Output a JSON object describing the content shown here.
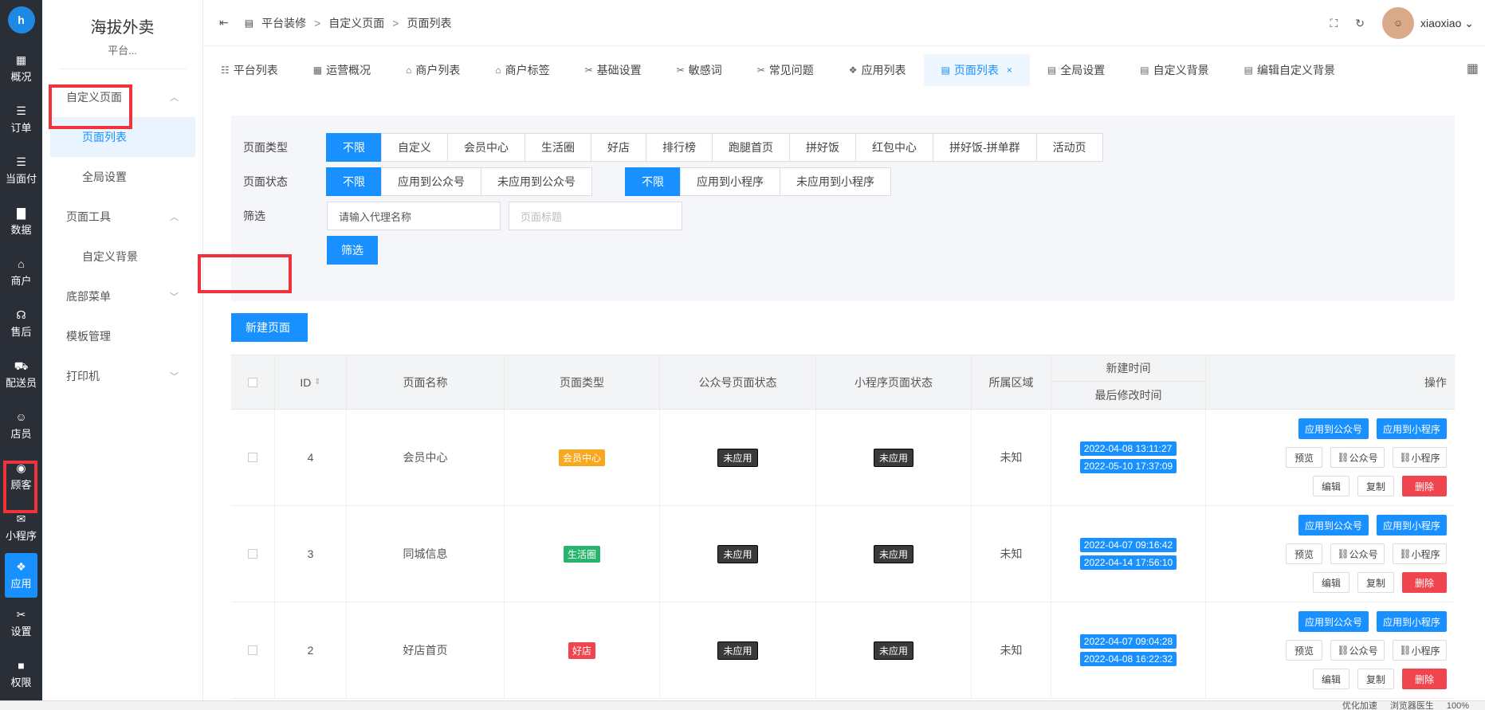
{
  "rail": {
    "items": [
      {
        "icon": "dashboard-icon",
        "glyph": "▦",
        "label": "概况"
      },
      {
        "icon": "list-icon",
        "glyph": "☰",
        "label": "订单"
      },
      {
        "icon": "list-icon",
        "glyph": "☰",
        "label": "当面付"
      },
      {
        "icon": "chart-icon",
        "glyph": "▇",
        "label": "数据"
      },
      {
        "icon": "store-icon",
        "glyph": "⌂",
        "label": "商户"
      },
      {
        "icon": "headset-icon",
        "glyph": "☊",
        "label": "售后"
      },
      {
        "icon": "truck-icon",
        "glyph": "⛟",
        "label": "配送员"
      },
      {
        "icon": "user-icon",
        "glyph": "☺",
        "label": "店员"
      },
      {
        "icon": "customer-icon",
        "glyph": "◉",
        "label": "顾客"
      },
      {
        "icon": "wechat-icon",
        "glyph": "✉",
        "label": "小程序"
      },
      {
        "icon": "apps-icon",
        "glyph": "❖",
        "label": "应用"
      },
      {
        "icon": "settings-icon",
        "glyph": "✂",
        "label": "设置"
      },
      {
        "icon": "lock-icon",
        "glyph": "■",
        "label": "权限"
      }
    ]
  },
  "sidebar": {
    "brand": "海拔外卖",
    "brand_sub": "平台...",
    "groups": [
      {
        "label": "自定义页面",
        "chev": "^"
      },
      {
        "label": "页面工具",
        "chev": "^"
      },
      {
        "label": "底部菜单",
        "chev": "v"
      },
      {
        "label": "模板管理",
        "chev": ""
      },
      {
        "label": "打印机",
        "chev": "v"
      }
    ],
    "subs": [
      "页面列表",
      "全局设置",
      "自定义背景"
    ]
  },
  "header": {
    "fold_icon": "⇤",
    "crumbs": [
      "平台装修",
      ">",
      "自定义页面",
      ">",
      "页面列表"
    ],
    "username": "xiaoxiao"
  },
  "tabs": [
    {
      "icon": "☷",
      "label": "平台列表"
    },
    {
      "icon": "▦",
      "label": "运营概况"
    },
    {
      "icon": "⌂",
      "label": "商户列表"
    },
    {
      "icon": "⌂",
      "label": "商户标签"
    },
    {
      "icon": "✂",
      "label": "基础设置"
    },
    {
      "icon": "✂",
      "label": "敏感词"
    },
    {
      "icon": "✂",
      "label": "常见问题"
    },
    {
      "icon": "❖",
      "label": "应用列表"
    },
    {
      "icon": "▤",
      "label": "页面列表",
      "active": true
    },
    {
      "icon": "▤",
      "label": "全局设置"
    },
    {
      "icon": "▤",
      "label": "自定义背景"
    },
    {
      "icon": "▤",
      "label": "编辑自定义背景"
    }
  ],
  "filter": {
    "type_label": "页面类型",
    "types": [
      "不限",
      "自定义",
      "会员中心",
      "生活圈",
      "好店",
      "排行榜",
      "跑腿首页",
      "拼好饭",
      "红包中心",
      "拼好饭-拼单群",
      "活动页"
    ],
    "status_label": "页面状态",
    "status_mp": [
      "不限",
      "应用到公众号",
      "未应用到公众号"
    ],
    "status_app": [
      "不限",
      "应用到小程序",
      "未应用到小程序"
    ],
    "search_label": "筛选",
    "agent_value": "请输入代理名称",
    "title_placeholder": "页面标题",
    "submit": "筛选"
  },
  "new_page": "新建页面",
  "table": {
    "headers": {
      "id": "ID",
      "name": "页面名称",
      "type": "页面类型",
      "mp_status": "公众号页面状态",
      "app_status": "小程序页面状态",
      "region": "所属区域",
      "created": "新建时间",
      "modified": "最后修改时间",
      "ops": "操作"
    },
    "rows": [
      {
        "id": "4",
        "name": "会员中心",
        "type": "会员中心",
        "type_color": "y",
        "mp": "未应用",
        "app": "未应用",
        "region": "未知",
        "created": "2022-04-08 13:11:27",
        "modified": "2022-05-10 17:37:09"
      },
      {
        "id": "3",
        "name": "同城信息",
        "type": "生活圈",
        "type_color": "g",
        "mp": "未应用",
        "app": "未应用",
        "region": "未知",
        "created": "2022-04-07 09:16:42",
        "modified": "2022-04-14 17:56:10"
      },
      {
        "id": "2",
        "name": "好店首页",
        "type": "好店",
        "type_color": "r",
        "mp": "未应用",
        "app": "未应用",
        "region": "未知",
        "created": "2022-04-07 09:04:28",
        "modified": "2022-04-08 16:22:32"
      }
    ],
    "ops": {
      "apply_mp": "应用到公众号",
      "apply_app": "应用到小程序",
      "preview": "预览",
      "mp": "公众号",
      "app": "小程序",
      "edit": "编辑",
      "copy": "复制",
      "delete": "删除"
    }
  },
  "statusbar": [
    "优化加速",
    "浏览器医生",
    "100%"
  ]
}
